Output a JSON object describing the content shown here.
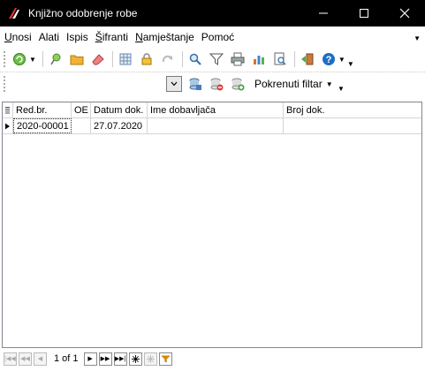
{
  "window": {
    "title": "Knjižno odobrenje robe"
  },
  "menu": {
    "items": [
      {
        "label": "Unosi",
        "mnemonic": "U",
        "rest": "nosi"
      },
      {
        "label": "Alati",
        "mnemonic": "",
        "rest": "Alati"
      },
      {
        "label": "Ispis",
        "mnemonic": "",
        "rest": "Ispis"
      },
      {
        "label": "Šifranti",
        "mnemonic": "Š",
        "rest": "ifranti"
      },
      {
        "label": "Namještanje",
        "mnemonic": "N",
        "rest": "amještanje"
      },
      {
        "label": "Pomoć",
        "mnemonic": "",
        "rest": "Pomoć"
      }
    ]
  },
  "filter_toolbar": {
    "filter_label": "Pokrenuti filtar"
  },
  "grid": {
    "columns": [
      "Red.br.",
      "OE",
      "Datum dok.",
      "Ime dobavljača",
      "Broj dok."
    ],
    "rows": [
      {
        "red_br": "2020-00001",
        "oe": "",
        "datum": "27.07.2020",
        "ime": "",
        "broj": ""
      }
    ]
  },
  "navigator": {
    "page_text": "1 of 1"
  },
  "colors": {
    "titlebar": "#000000",
    "accent_green": "#5aa02c",
    "help_blue": "#1e6fc4",
    "filter_orange": "#e08a00"
  }
}
